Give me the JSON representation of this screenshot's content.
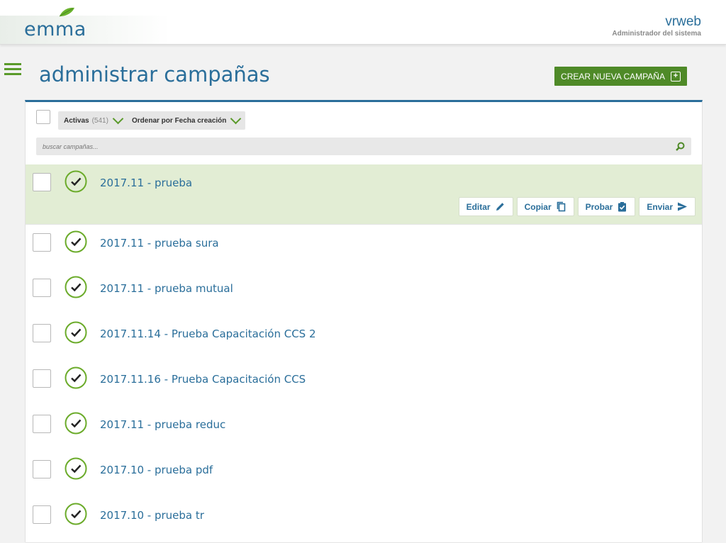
{
  "brand": {
    "logo_text": "emma"
  },
  "user": {
    "name": "vrweb",
    "role": "Administrador del sistema"
  },
  "page": {
    "title": "administrar campañas",
    "create_label": "CREAR NUEVA CAMPAÑA"
  },
  "filters": {
    "status_label": "Activas",
    "status_count": "(541)",
    "sort_label": "Ordenar por Fecha creación"
  },
  "search": {
    "placeholder": "buscar campañas..."
  },
  "actions": {
    "edit": "Editar",
    "copy": "Copiar",
    "test": "Probar",
    "send": "Enviar"
  },
  "campaigns": [
    {
      "name": "2017.11 - prueba"
    },
    {
      "name": "2017.11 - prueba sura"
    },
    {
      "name": "2017.11 - prueba mutual"
    },
    {
      "name": "2017.11.14 - Prueba Capacitación CCS 2"
    },
    {
      "name": "2017.11.16 - Prueba Capacitación CCS"
    },
    {
      "name": "2017.11 - prueba reduc"
    },
    {
      "name": "2017.10 - prueba pdf"
    },
    {
      "name": "2017.10 - prueba tr"
    }
  ],
  "colors": {
    "accent_blue": "#2a6e9a",
    "accent_green": "#4f8a28",
    "selected_row": "#e2edd4"
  }
}
